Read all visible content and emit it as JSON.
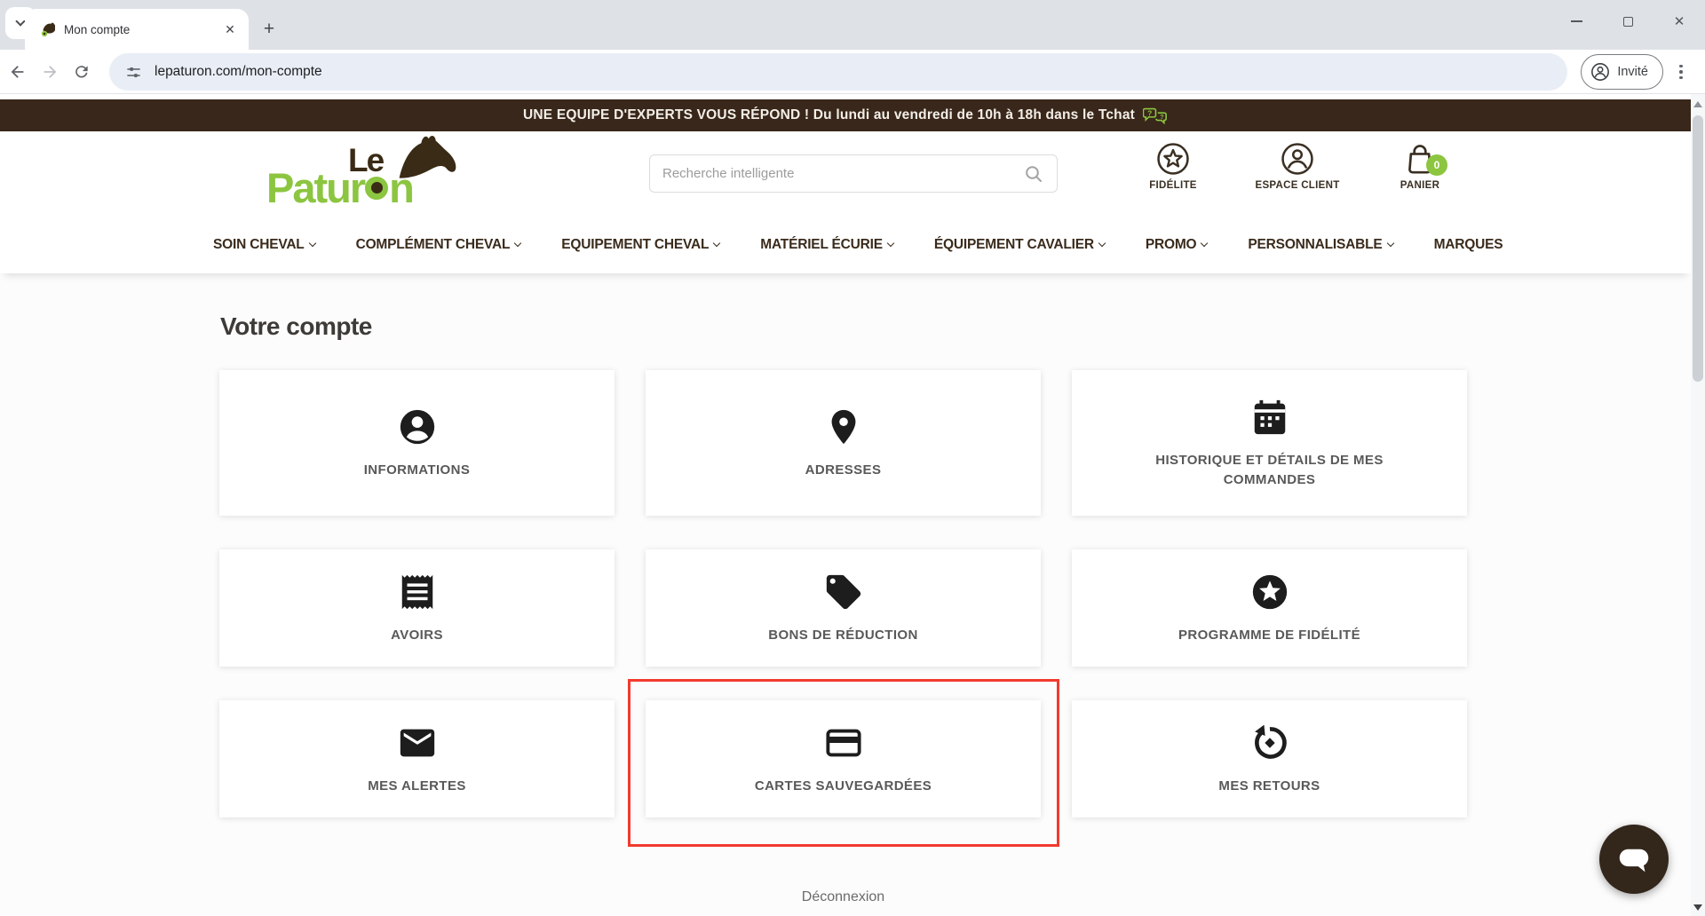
{
  "browser": {
    "tab_title": "Mon compte",
    "url": "lepaturon.com/mon-compte",
    "profile_label": "Invité",
    "new_tab_label": "+"
  },
  "topbar": {
    "message": "UNE EQUIPE D'EXPERTS VOUS RÉPOND ! Du lundi au vendredi de 10h à 18h dans le Tchat"
  },
  "header": {
    "logo": {
      "line1": "Le",
      "word_pre": "Patur",
      "word_post": "n"
    },
    "search_placeholder": "Recherche intelligente",
    "actions": [
      {
        "label": "FIDÉLITE",
        "icon": "star-circle-icon"
      },
      {
        "label": "ESPACE CLIENT",
        "icon": "user-circle-icon"
      },
      {
        "label": "PANIER",
        "icon": "shopping-bag-icon",
        "badge": "0"
      }
    ]
  },
  "nav": {
    "items": [
      {
        "label": "SOIN CHEVAL",
        "chevron": true
      },
      {
        "label": "COMPLÉMENT CHEVAL",
        "chevron": true
      },
      {
        "label": "EQUIPEMENT CHEVAL",
        "chevron": true
      },
      {
        "label": "MATÉRIEL ÉCURIE",
        "chevron": true
      },
      {
        "label": "ÉQUIPEMENT CAVALIER",
        "chevron": true
      },
      {
        "label": "PROMO",
        "chevron": true
      },
      {
        "label": "PERSONNALISABLE",
        "chevron": true
      },
      {
        "label": "MARQUES",
        "chevron": false
      }
    ]
  },
  "account": {
    "heading": "Votre compte",
    "cards": [
      {
        "label": "INFORMATIONS",
        "icon": "person-circle-icon"
      },
      {
        "label": "ADRESSES",
        "icon": "map-pin-icon"
      },
      {
        "label": "HISTORIQUE ET DÉTAILS DE MES COMMANDES",
        "icon": "calendar-icon"
      },
      {
        "label": "AVOIRS",
        "icon": "receipt-icon"
      },
      {
        "label": "BONS DE RÉDUCTION",
        "icon": "tag-icon"
      },
      {
        "label": "PROGRAMME DE FIDÉLITÉ",
        "icon": "star-badge-icon"
      },
      {
        "label": "MES ALERTES",
        "icon": "envelope-icon"
      },
      {
        "label": "CARTES SAUVEGARDÉES",
        "icon": "credit-card-icon",
        "highlighted": true
      },
      {
        "label": "MES RETOURS",
        "icon": "return-arrow-icon"
      }
    ],
    "logout_label": "Déconnexion"
  },
  "colors": {
    "brand_green": "#8cc540",
    "brand_brown": "#38271a",
    "highlight_red": "#f23a2e"
  }
}
